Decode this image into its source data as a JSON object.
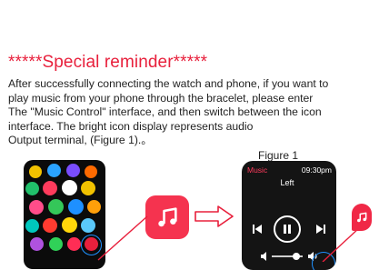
{
  "title": "*****Special reminder*****",
  "paragraph_lines": [
    "After successfully connecting the watch and phone, if you want to",
    "play music from your phone through the bracelet, please enter",
    "The \"Music Control\" interface, and then switch between the icon",
    "interface. The bright icon display represents audio",
    "Output terminal, (Figure 1).。"
  ],
  "figure_caption": "Figure 1",
  "watch": {
    "app_label": "Music",
    "time": "09:30pm",
    "side_label": "Left",
    "volume_level": 0.8
  },
  "colors": {
    "accent_red": "#e8203c",
    "music_icon_bg": "#f5334f",
    "highlight_blue": "#1e90ff"
  },
  "icons": [
    "music-note-icon",
    "right-arrow-icon",
    "play-pause-icon",
    "previous-track-icon",
    "next-track-icon",
    "volume-low-icon",
    "volume-high-icon"
  ]
}
